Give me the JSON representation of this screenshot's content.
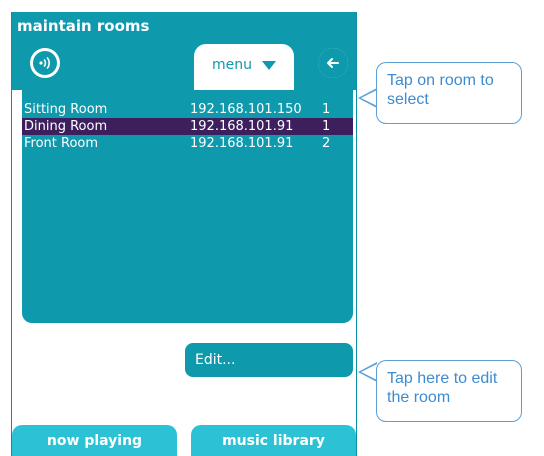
{
  "title": "maintain rooms",
  "toolbar": {
    "speaker_icon": "speaker-icon",
    "menu_label": "menu",
    "back_icon": "back-arrow-icon"
  },
  "rooms": [
    {
      "name": "Sitting Room",
      "ip": "192.168.101.150",
      "num": "1",
      "selected": false
    },
    {
      "name": "Dining Room",
      "ip": "192.168.101.91",
      "num": "1",
      "selected": true
    },
    {
      "name": "Front Room",
      "ip": "192.168.101.91",
      "num": "2",
      "selected": false
    }
  ],
  "edit_label": "Edit...",
  "tabs": {
    "now_playing": "now playing",
    "music_library": "music library"
  },
  "callouts": {
    "select": "Tap on room to select",
    "edit": "Tap here to edit the room"
  },
  "colors": {
    "teal": "#0e99ad",
    "light_teal": "#2bc2d6",
    "selected": "#3d1f5e",
    "callout_blue": "#3e8bd0"
  }
}
